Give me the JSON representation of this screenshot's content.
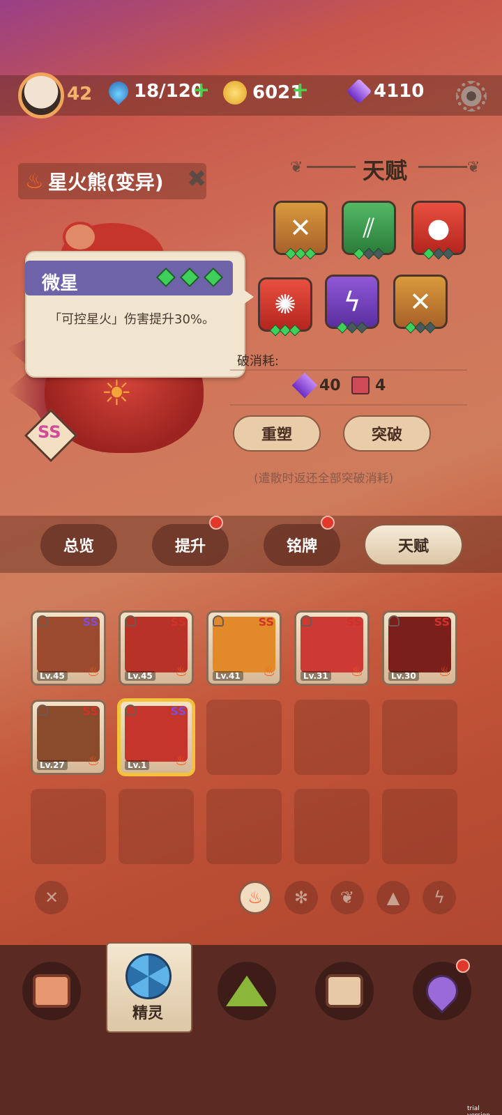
{
  "header": {
    "player_level": "42",
    "stamina": "18/120",
    "coins": "6021",
    "gems": "4110"
  },
  "creature": {
    "name": "星火熊(变异)",
    "rank": "SS"
  },
  "talent": {
    "title": "天赋",
    "skills_row1": [
      {
        "icon": "crossed-claws-icon",
        "color": "brown",
        "gems": [
          true,
          true,
          true
        ]
      },
      {
        "icon": "claw-slash-icon",
        "color": "green",
        "gems": [
          true,
          false,
          false
        ]
      },
      {
        "icon": "flame-drop-icon",
        "color": "red",
        "gems": [
          true,
          false,
          false
        ]
      }
    ],
    "skills_row2": [
      {
        "icon": "fire-ring-icon",
        "color": "red",
        "gems": [
          true,
          true,
          true
        ]
      },
      {
        "icon": "lightning-icon",
        "color": "purple",
        "gems": [
          true,
          false,
          false
        ]
      },
      {
        "icon": "crossed-claws-icon",
        "color": "brown",
        "gems": [
          true,
          false,
          false
        ]
      }
    ],
    "breakthrough_label": "破消耗:",
    "cost_gems": "40",
    "cost_books": "4",
    "reshape_button": "重塑",
    "breakthrough_button": "突破",
    "refund_note": "(遣散时返还全部突破消耗)"
  },
  "tooltip": {
    "title": "微星",
    "description": "「可控星火」伤害提升30%。"
  },
  "tabs": [
    {
      "label": "总览",
      "badge": false,
      "active": false
    },
    {
      "label": "提升",
      "badge": true,
      "active": false
    },
    {
      "label": "铭牌",
      "badge": true,
      "active": false
    },
    {
      "label": "天赋",
      "badge": false,
      "active": true
    }
  ],
  "creatures": [
    {
      "level": "Lv.45",
      "rank": "SS",
      "rainbow": true,
      "art": "#9c4a2e"
    },
    {
      "level": "Lv.45",
      "rank": "SS",
      "rainbow": false,
      "art": "#b83228"
    },
    {
      "level": "Lv.41",
      "rank": "SS",
      "rainbow": false,
      "art": "#e2892a"
    },
    {
      "level": "Lv.31",
      "rank": "SS",
      "rainbow": false,
      "art": "#cc3a33"
    },
    {
      "level": "Lv.30",
      "rank": "SS",
      "rainbow": false,
      "art": "#7a1f1a"
    },
    {
      "level": "Lv.27",
      "rank": "SS",
      "rainbow": false,
      "art": "#8a4a2c"
    },
    {
      "level": "Lv.1",
      "rank": "SS",
      "rainbow": true,
      "art": "#c6352c"
    }
  ],
  "filters": [
    "close-icon",
    "fire-icon",
    "snowflake-icon",
    "leaf-icon",
    "rock-icon",
    "lightning-icon"
  ],
  "bottom_nav": {
    "active_label": "精灵"
  },
  "watermark": "trial version"
}
